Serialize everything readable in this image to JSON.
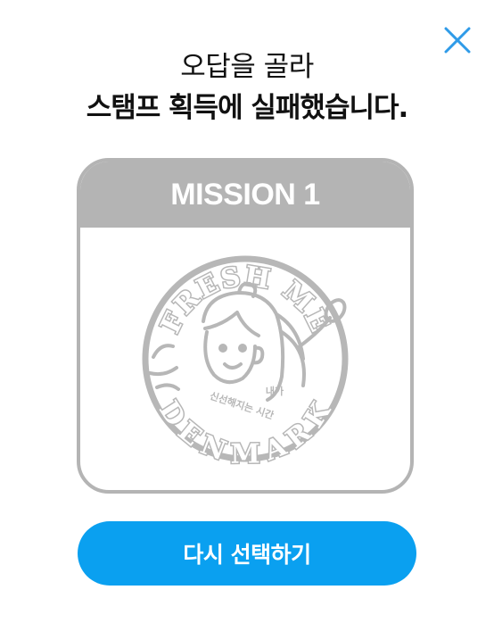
{
  "dialog": {
    "close_icon": "close-icon",
    "title_line1": "오답을 골라",
    "title_line2": "스탬프 획득에 실패했습니다.",
    "mission_label": "MISSION 1",
    "retry_button_label": "다시 선택하기"
  },
  "stamp": {
    "top_text": "FRESH ME",
    "bottom_text": "DENMARK",
    "tagline_line1": "내가",
    "tagline_line2": "신선해지는 시간",
    "state": "grayed-out"
  },
  "colors": {
    "accent": "#0aa0f0",
    "close_icon": "#2f9be8",
    "card_border": "#b4b4b4",
    "stamp_gray": "#b7b7b7"
  }
}
